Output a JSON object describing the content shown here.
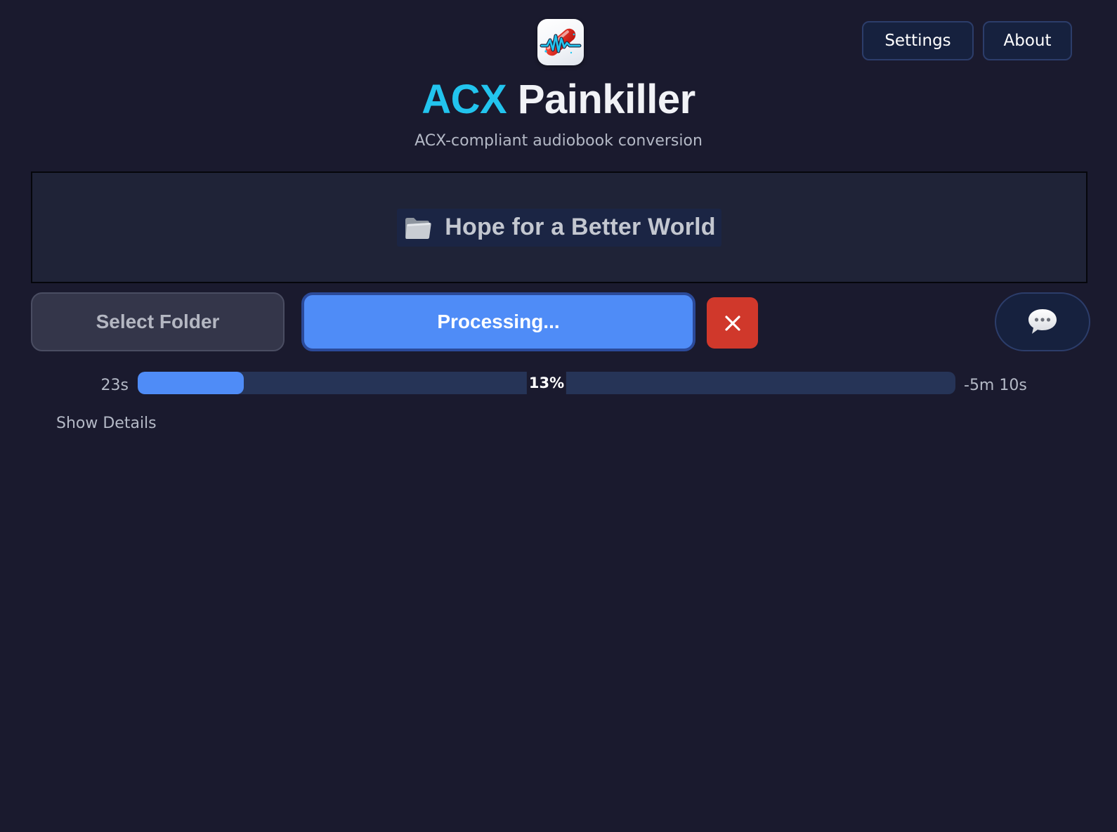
{
  "header": {
    "icon": "pill-waveform-icon",
    "title_accent": "ACX",
    "title_rest": "Painkiller",
    "subtitle": "ACX-compliant audiobook conversion",
    "settings_label": "Settings",
    "about_label": "About"
  },
  "dropzone": {
    "icon": "folder-icon",
    "folder_name": "Hope for a Better World"
  },
  "controls": {
    "select_folder_label": "Select Folder",
    "processing_label": "Processing...",
    "cancel_icon": "close-icon",
    "chat_icon": "chat-bubble-icon"
  },
  "progress": {
    "elapsed": "23s",
    "percent": 13,
    "percent_label": "13%",
    "remaining": "-5m 10s"
  },
  "details": {
    "toggle_label": "Show Details"
  },
  "colors": {
    "background": "#1a1a2e",
    "accent": "#22c4ee",
    "primary": "#4f8cf7",
    "danger": "#d0382b"
  }
}
